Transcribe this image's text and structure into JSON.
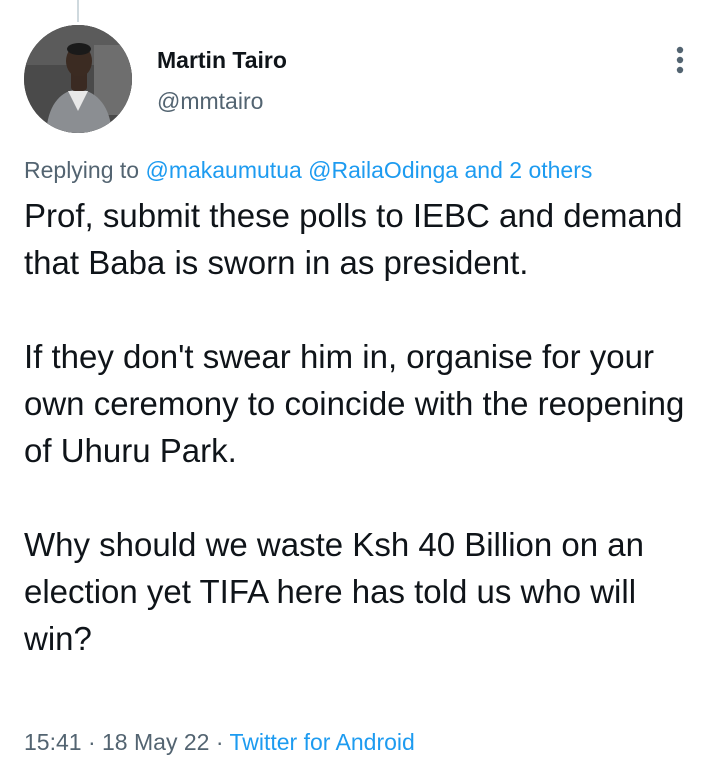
{
  "tweet": {
    "author": {
      "name": "Martin Tairo",
      "handle": "@mmtairo"
    },
    "reply_context": {
      "prefix": "Replying to",
      "mentions": [
        "@makaumutua",
        "@RailaOdinga"
      ],
      "suffix": "and 2 others"
    },
    "paragraphs": [
      "Prof, submit these polls to IEBC and demand that Baba is sworn in as president.",
      "If they don't swear him in, organise for your own ceremony to coincide with the reopening of Uhuru Park.",
      "Why should we waste Ksh 40 Billion on an election yet TIFA here has told us who will win?"
    ],
    "meta": {
      "time": "15:41",
      "separator": "·",
      "date": "18 May 22",
      "source": "Twitter for Android"
    }
  },
  "icons": {
    "more": "more-vertical-icon"
  },
  "colors": {
    "text": "#0f1419",
    "secondary": "#536471",
    "accent": "#1d9bf0",
    "thread_line": "#cfd9de"
  }
}
